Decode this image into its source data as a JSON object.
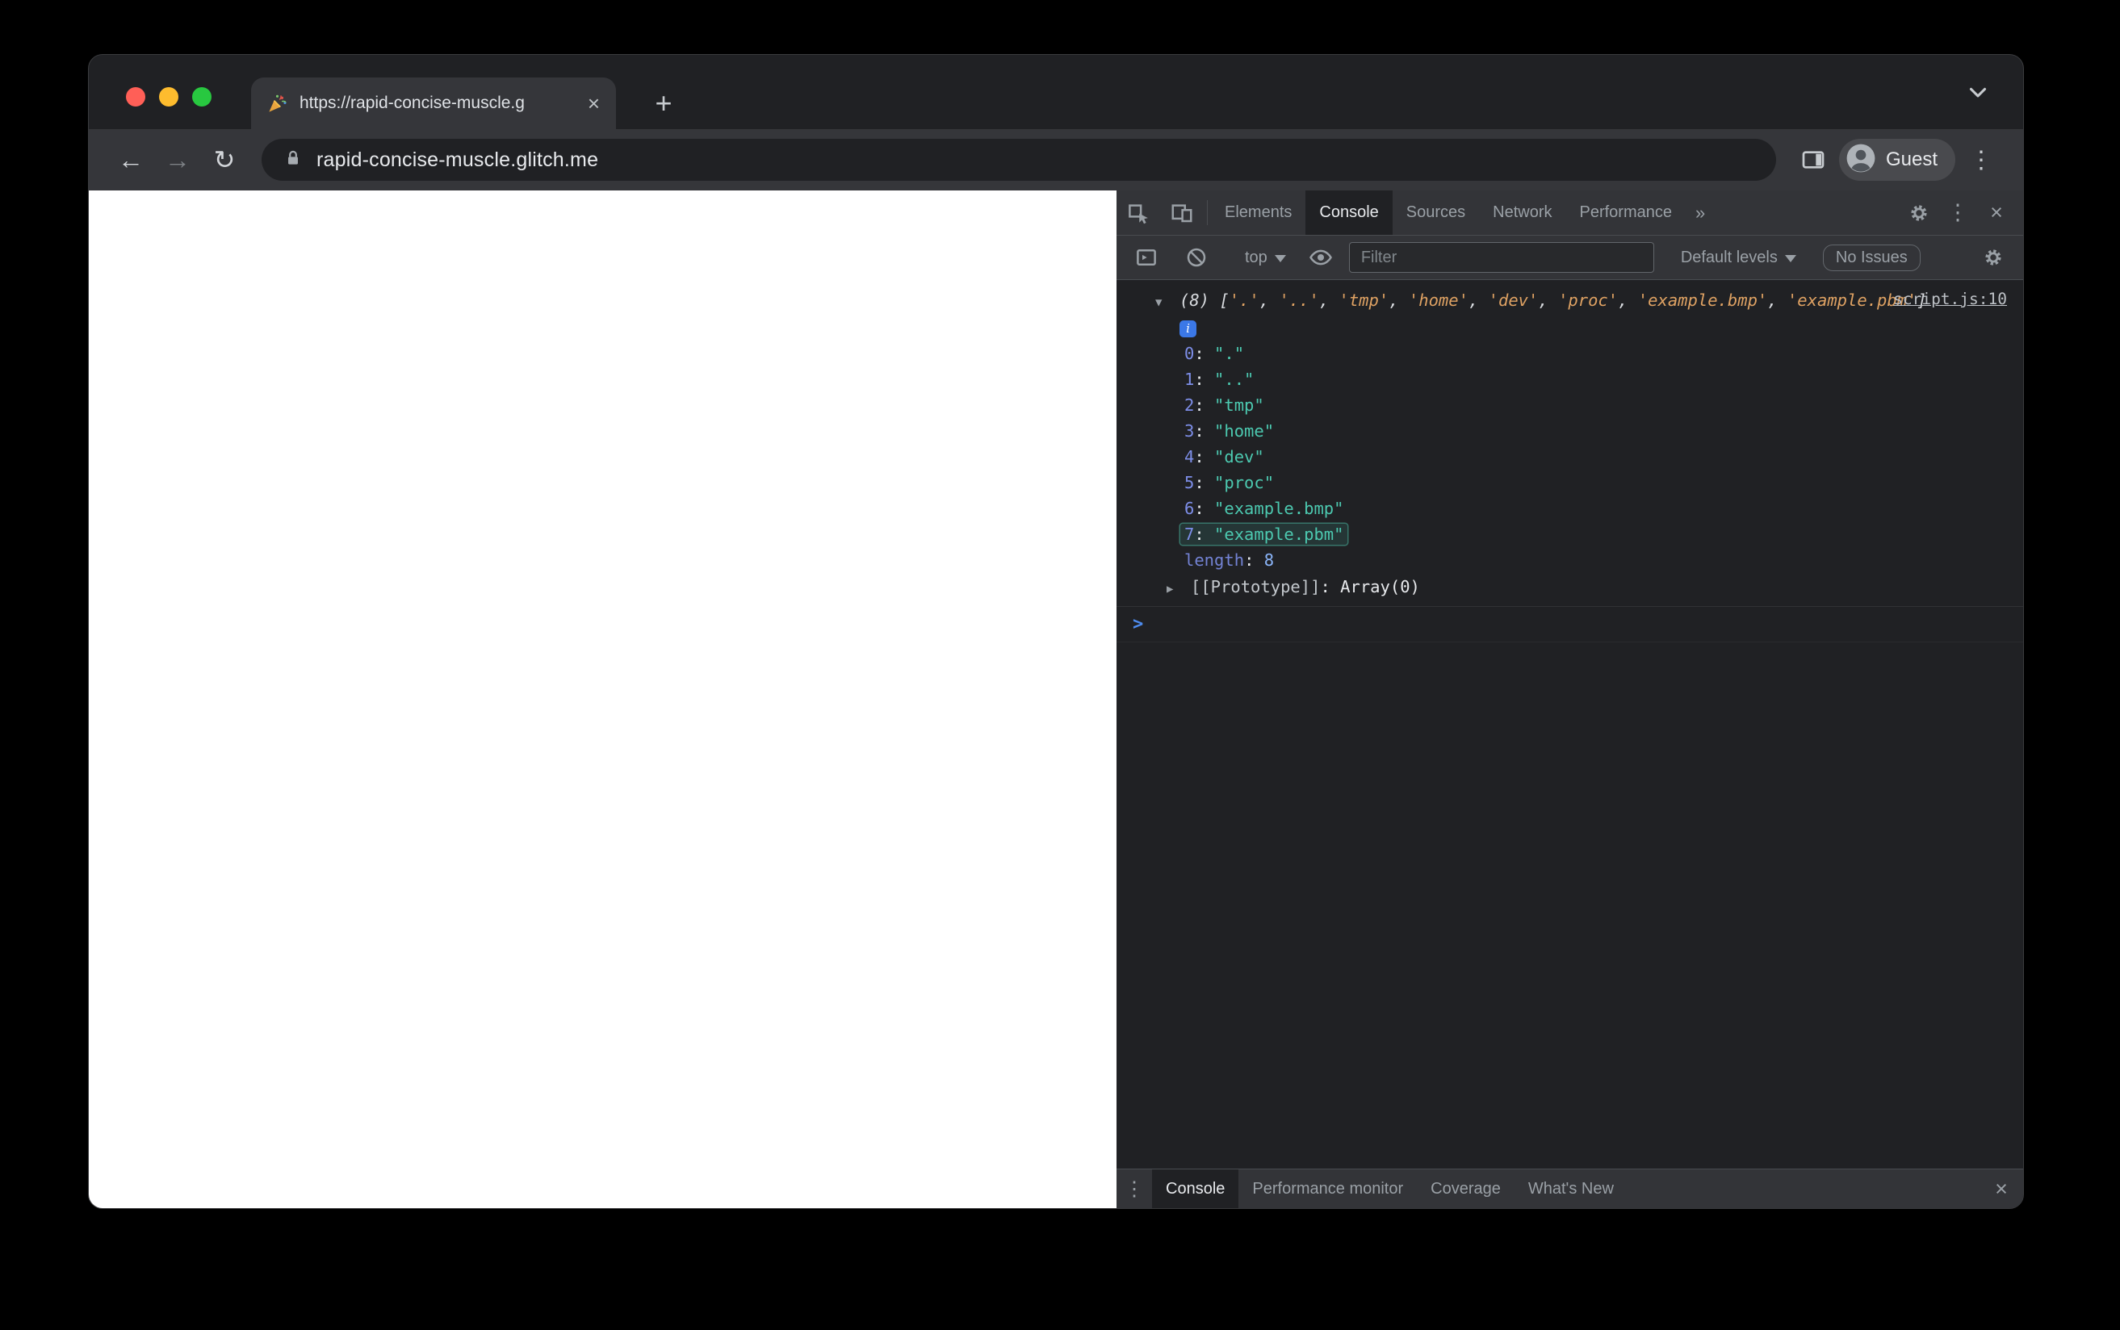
{
  "browser": {
    "tab_title": "https://rapid-concise-muscle.g",
    "tab_favicon": "party-popper",
    "url": "rapid-concise-muscle.glitch.me",
    "profile_label": "Guest"
  },
  "devtools": {
    "tabs": [
      {
        "label": "Elements",
        "selected": false
      },
      {
        "label": "Console",
        "selected": true
      },
      {
        "label": "Sources",
        "selected": false
      },
      {
        "label": "Network",
        "selected": false
      },
      {
        "label": "Performance",
        "selected": false
      }
    ],
    "toolbar": {
      "context_label": "top",
      "filter_placeholder": "Filter",
      "levels_label": "Default levels",
      "issues_label": "No Issues"
    },
    "console": {
      "source_link": "script.js:10",
      "array_length": 8,
      "items": [
        ".",
        "..",
        "tmp",
        "home",
        "dev",
        "proc",
        "example.bmp",
        "example.pbm"
      ],
      "highlighted_index": 7,
      "length_label": "length",
      "length_value": "8",
      "prototype_label": "[[Prototype]]",
      "prototype_value": "Array(0)"
    },
    "drawer_tabs": [
      {
        "label": "Console",
        "selected": true
      },
      {
        "label": "Performance monitor",
        "selected": false
      },
      {
        "label": "Coverage",
        "selected": false
      },
      {
        "label": "What's New",
        "selected": false
      }
    ]
  },
  "icons": {
    "back": "←",
    "forward": "→",
    "reload": "↻",
    "close": "×",
    "new_tab": "+",
    "menu_kebab": "⋮",
    "more_tabs": "»",
    "triangle_open": "▼",
    "triangle_closed": "▶",
    "prompt": ">",
    "info": "i"
  },
  "colors": {
    "traffic_red": "#ff5f57",
    "traffic_yellow": "#febc2e",
    "traffic_green": "#28c840",
    "devtools_bg": "#202124",
    "devtools_toolbar": "#333438",
    "string_preview": "#dfa263",
    "string_value": "#4cc9b0",
    "index_key": "#7d8ee8",
    "number_value": "#8ab4f8",
    "prompt_blue": "#4e8cef",
    "link": "#bdc1c6",
    "info_badge": "#3b78e7"
  }
}
